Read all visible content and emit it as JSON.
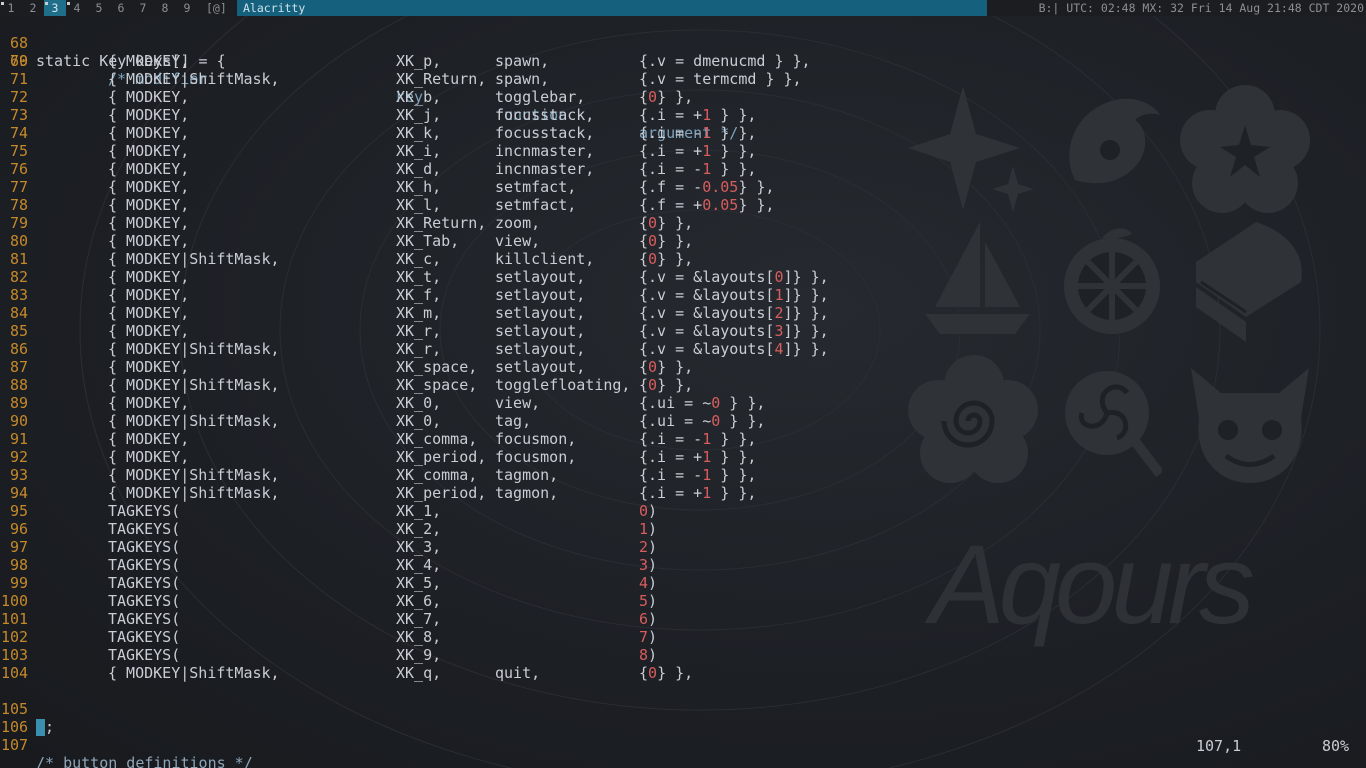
{
  "bar": {
    "tags": [
      {
        "label": "1",
        "dot": true
      },
      {
        "label": "2",
        "dot": false
      },
      {
        "label": "3",
        "dot": true
      },
      {
        "label": "4",
        "dot": true
      },
      {
        "label": "5",
        "dot": false
      },
      {
        "label": "6",
        "dot": false
      },
      {
        "label": "7",
        "dot": false
      },
      {
        "label": "8",
        "dot": false
      },
      {
        "label": "9",
        "dot": false
      }
    ],
    "selected_tag": "3",
    "layout_symbol": "[@]",
    "window_title": "Alacritty",
    "status_text": "B:| UTC: 02:48 MX: 32 Fri 14 Aug 21:48 CDT 2020"
  },
  "editor": {
    "header_line": {
      "num": "68",
      "text": "static Key keys[] = {"
    },
    "columns_header": {
      "num": "69",
      "a": "/* modifier",
      "b": "key",
      "c": "function",
      "d": "argument */"
    },
    "rows": [
      {
        "num": "70",
        "mod": "{ MODKEY,",
        "key": "XK_p,",
        "fn": "spawn,",
        "arg": "{.v = dmenucmd } },"
      },
      {
        "num": "71",
        "mod": "{ MODKEY|ShiftMask,",
        "key": "XK_Return,",
        "fn": "spawn,",
        "arg": "{.v = termcmd } },"
      },
      {
        "num": "72",
        "mod": "{ MODKEY,",
        "key": "XK_b,",
        "fn": "togglebar,",
        "arg": "{0} },"
      },
      {
        "num": "73",
        "mod": "{ MODKEY,",
        "key": "XK_j,",
        "fn": "focusstack,",
        "arg": "{.i = +1 } },"
      },
      {
        "num": "74",
        "mod": "{ MODKEY,",
        "key": "XK_k,",
        "fn": "focusstack,",
        "arg": "{.i = -1 } },"
      },
      {
        "num": "75",
        "mod": "{ MODKEY,",
        "key": "XK_i,",
        "fn": "incnmaster,",
        "arg": "{.i = +1 } },"
      },
      {
        "num": "76",
        "mod": "{ MODKEY,",
        "key": "XK_d,",
        "fn": "incnmaster,",
        "arg": "{.i = -1 } },"
      },
      {
        "num": "77",
        "mod": "{ MODKEY,",
        "key": "XK_h,",
        "fn": "setmfact,",
        "arg": "{.f = -0.05} },"
      },
      {
        "num": "78",
        "mod": "{ MODKEY,",
        "key": "XK_l,",
        "fn": "setmfact,",
        "arg": "{.f = +0.05} },"
      },
      {
        "num": "79",
        "mod": "{ MODKEY,",
        "key": "XK_Return,",
        "fn": "zoom,",
        "arg": "{0} },"
      },
      {
        "num": "80",
        "mod": "{ MODKEY,",
        "key": "XK_Tab,",
        "fn": "view,",
        "arg": "{0} },"
      },
      {
        "num": "81",
        "mod": "{ MODKEY|ShiftMask,",
        "key": "XK_c,",
        "fn": "killclient,",
        "arg": "{0} },"
      },
      {
        "num": "82",
        "mod": "{ MODKEY,",
        "key": "XK_t,",
        "fn": "setlayout,",
        "arg": "{.v = &layouts[0]} },"
      },
      {
        "num": "83",
        "mod": "{ MODKEY,",
        "key": "XK_f,",
        "fn": "setlayout,",
        "arg": "{.v = &layouts[1]} },"
      },
      {
        "num": "84",
        "mod": "{ MODKEY,",
        "key": "XK_m,",
        "fn": "setlayout,",
        "arg": "{.v = &layouts[2]} },"
      },
      {
        "num": "85",
        "mod": "{ MODKEY,",
        "key": "XK_r,",
        "fn": "setlayout,",
        "arg": "{.v = &layouts[3]} },"
      },
      {
        "num": "86",
        "mod": "{ MODKEY|ShiftMask,",
        "key": "XK_r,",
        "fn": "setlayout,",
        "arg": "{.v = &layouts[4]} },"
      },
      {
        "num": "87",
        "mod": "{ MODKEY,",
        "key": "XK_space,",
        "fn": "setlayout,",
        "arg": "{0} },"
      },
      {
        "num": "88",
        "mod": "{ MODKEY|ShiftMask,",
        "key": "XK_space,",
        "fn": "togglefloating,",
        "arg": "{0} },"
      },
      {
        "num": "89",
        "mod": "{ MODKEY,",
        "key": "XK_0,",
        "fn": "view,",
        "arg": "{.ui = ~0 } },"
      },
      {
        "num": "90",
        "mod": "{ MODKEY|ShiftMask,",
        "key": "XK_0,",
        "fn": "tag,",
        "arg": "{.ui = ~0 } },"
      },
      {
        "num": "91",
        "mod": "{ MODKEY,",
        "key": "XK_comma,",
        "fn": "focusmon,",
        "arg": "{.i = -1 } },"
      },
      {
        "num": "92",
        "mod": "{ MODKEY,",
        "key": "XK_period,",
        "fn": "focusmon,",
        "arg": "{.i = +1 } },"
      },
      {
        "num": "93",
        "mod": "{ MODKEY|ShiftMask,",
        "key": "XK_comma,",
        "fn": "tagmon,",
        "arg": "{.i = -1 } },"
      },
      {
        "num": "94",
        "mod": "{ MODKEY|ShiftMask,",
        "key": "XK_period,",
        "fn": "tagmon,",
        "arg": "{.i = +1 } },"
      },
      {
        "num": "95",
        "mod": "TAGKEYS(",
        "key": "XK_1,",
        "fn": "",
        "arg": "0)"
      },
      {
        "num": "96",
        "mod": "TAGKEYS(",
        "key": "XK_2,",
        "fn": "",
        "arg": "1)"
      },
      {
        "num": "97",
        "mod": "TAGKEYS(",
        "key": "XK_3,",
        "fn": "",
        "arg": "2)"
      },
      {
        "num": "98",
        "mod": "TAGKEYS(",
        "key": "XK_4,",
        "fn": "",
        "arg": "3)"
      },
      {
        "num": "99",
        "mod": "TAGKEYS(",
        "key": "XK_5,",
        "fn": "",
        "arg": "4)"
      },
      {
        "num": "100",
        "mod": "TAGKEYS(",
        "key": "XK_6,",
        "fn": "",
        "arg": "5)"
      },
      {
        "num": "101",
        "mod": "TAGKEYS(",
        "key": "XK_7,",
        "fn": "",
        "arg": "6)"
      },
      {
        "num": "102",
        "mod": "TAGKEYS(",
        "key": "XK_8,",
        "fn": "",
        "arg": "7)"
      },
      {
        "num": "103",
        "mod": "TAGKEYS(",
        "key": "XK_9,",
        "fn": "",
        "arg": "8)"
      },
      {
        "num": "104",
        "mod": "{ MODKEY|ShiftMask,",
        "key": "XK_q,",
        "fn": "quit,",
        "arg": "{0} },"
      }
    ],
    "close_line": {
      "num": "105",
      "text": "};"
    },
    "blank_line": {
      "num": "106",
      "text": ""
    },
    "last_line": {
      "num": "107",
      "text": "/* button definitions */"
    },
    "ruler_position": "107,1",
    "ruler_percent": "80%"
  },
  "wallpaper": {
    "logo_text": "Aqours",
    "icons": [
      "sparkle-icon",
      "dolphin-icon",
      "flower-icon",
      "ship-icon",
      "orange-icon",
      "piano-icon",
      "swirl-flower-icon",
      "candy-icon",
      "devil-icon"
    ]
  },
  "colors": {
    "line_number": "#c5892b",
    "number_literal": "#d85d5d",
    "comment": "#8ea6b8",
    "title_bar": "#15607d",
    "selected_tag": "#1f6f8b"
  }
}
